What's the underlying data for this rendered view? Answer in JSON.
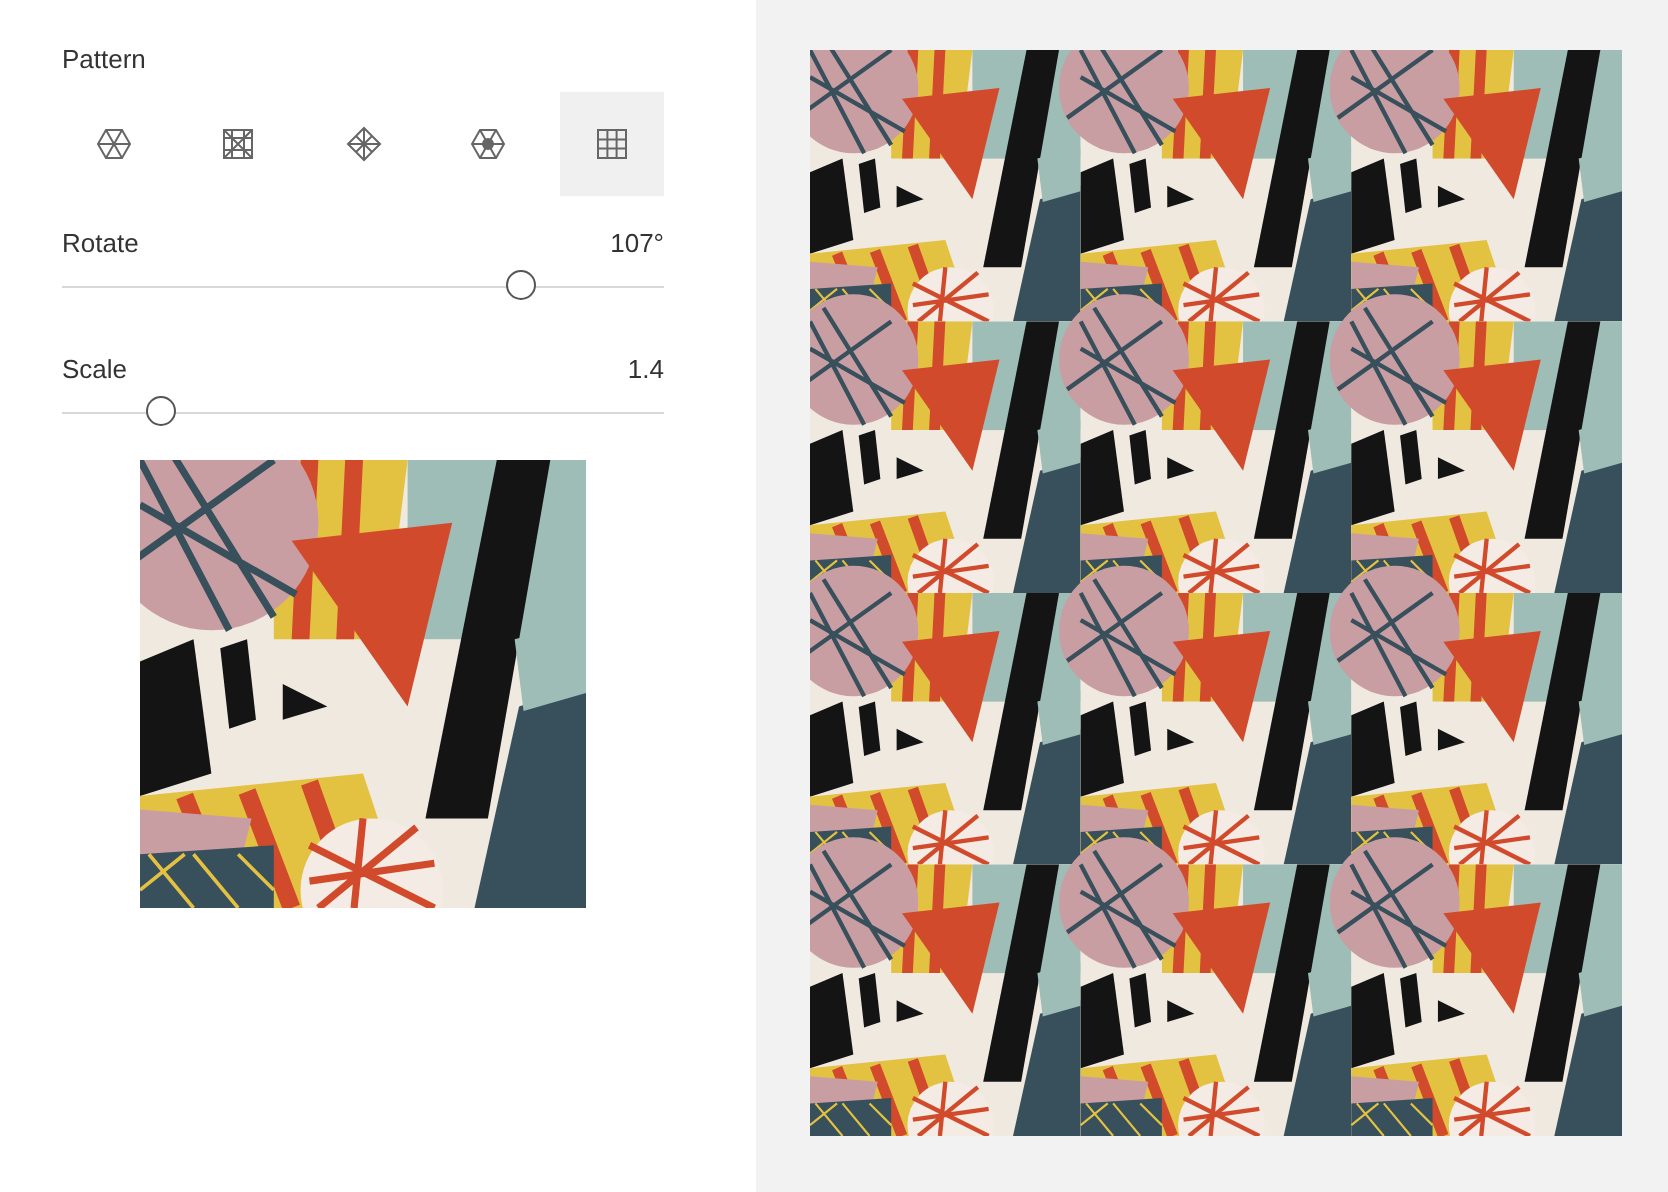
{
  "pattern": {
    "label": "Pattern",
    "options": [
      {
        "kind": "hexagon",
        "selected": false
      },
      {
        "kind": "square",
        "selected": false
      },
      {
        "kind": "diamond",
        "selected": false
      },
      {
        "kind": "octagon",
        "selected": false
      },
      {
        "kind": "grid",
        "selected": true
      }
    ]
  },
  "sliders": [
    {
      "label": "Rotate",
      "reading": "107°",
      "level": 0.78
    },
    {
      "label": "Scale",
      "reading": "1.4",
      "level": 0.146
    }
  ]
}
